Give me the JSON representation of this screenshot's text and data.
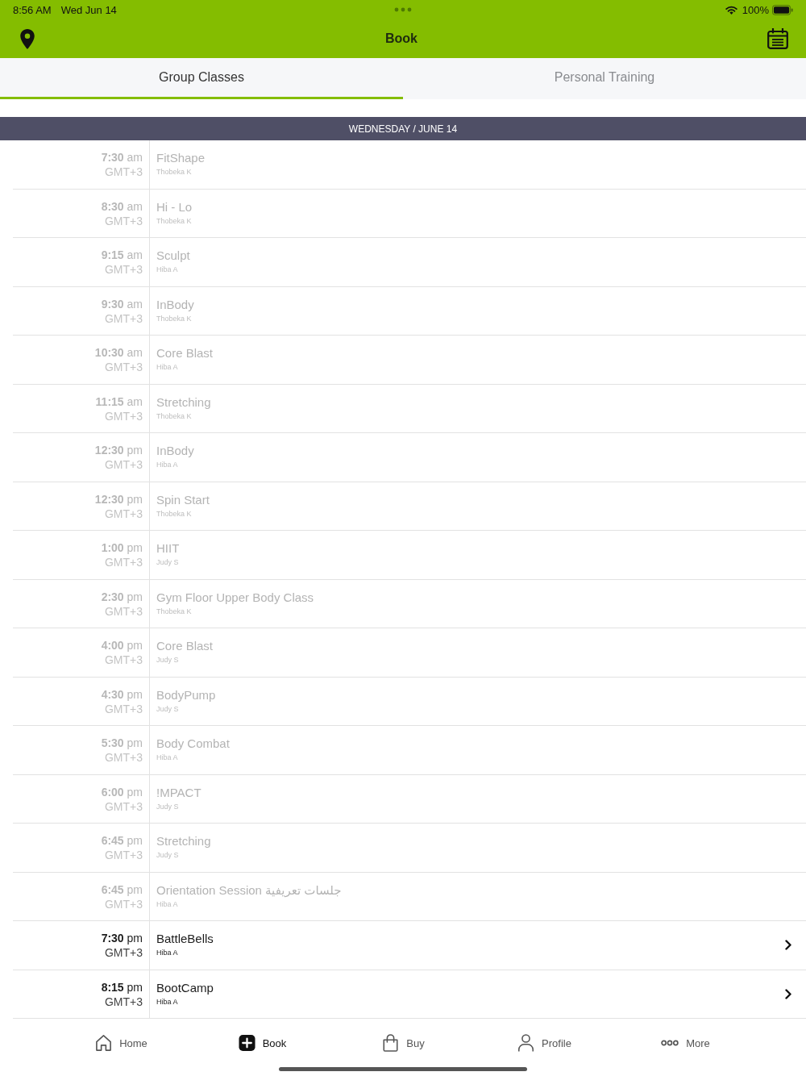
{
  "status_bar": {
    "time": "8:56 AM",
    "date": "Wed Jun 14",
    "battery": "100%"
  },
  "header": {
    "title": "Book"
  },
  "tabs": [
    {
      "label": "Group Classes",
      "selected": true
    },
    {
      "label": "Personal Training",
      "selected": false
    }
  ],
  "date_bar": "WEDNESDAY / JUNE 14",
  "classes": [
    {
      "time": "**7:30** am",
      "timezone": "GMT+3",
      "name": "FitShape",
      "instructor": "Thobeka K",
      "disabled": true
    },
    {
      "time": "**8:30** am",
      "timezone": "GMT+3",
      "name": "Hi - Lo",
      "instructor": "Thobeka K",
      "disabled": true
    },
    {
      "time": "**9:15** am",
      "timezone": "GMT+3",
      "name": "Sculpt",
      "instructor": "Hiba A",
      "disabled": true
    },
    {
      "time": "**9:30** am",
      "timezone": "GMT+3",
      "name": "InBody",
      "instructor": "Thobeka K",
      "disabled": true
    },
    {
      "time": "**10:30** am",
      "timezone": "GMT+3",
      "name": "Core Blast",
      "instructor": "Hiba A",
      "disabled": true
    },
    {
      "time": "**11:15** am",
      "timezone": "GMT+3",
      "name": "Stretching",
      "instructor": "Thobeka K",
      "disabled": true
    },
    {
      "time": "**12:30** pm",
      "timezone": "GMT+3",
      "name": "InBody",
      "instructor": "Hiba A",
      "disabled": true
    },
    {
      "time": "**12:30** pm",
      "timezone": "GMT+3",
      "name": "Spin Start",
      "instructor": "Thobeka K",
      "disabled": true
    },
    {
      "time": "**1:00** pm",
      "timezone": "GMT+3",
      "name": "HIIT",
      "instructor": "Judy S",
      "disabled": true
    },
    {
      "time": "**2:30** pm",
      "timezone": "GMT+3",
      "name": "Gym Floor Upper Body Class",
      "instructor": "Thobeka K",
      "disabled": true
    },
    {
      "time": "**4:00** pm",
      "timezone": "GMT+3",
      "name": "Core Blast",
      "instructor": "Judy S",
      "disabled": true
    },
    {
      "time": "**4:30** pm",
      "timezone": "GMT+3",
      "name": "BodyPump",
      "instructor": "Judy S",
      "disabled": true
    },
    {
      "time": "**5:30** pm",
      "timezone": "GMT+3",
      "name": "Body Combat",
      "instructor": "Hiba A",
      "disabled": true
    },
    {
      "time": "**6:00** pm",
      "timezone": "GMT+3",
      "name": "!MPACT",
      "instructor": "Judy S",
      "disabled": true
    },
    {
      "time": "**6:45** pm",
      "timezone": "GMT+3",
      "name": "Stretching",
      "instructor": "Judy S",
      "disabled": true
    },
    {
      "time": "**6:45** pm",
      "timezone": "GMT+3",
      "name": "Orientation Session جلسات تعريفية",
      "instructor": "Hiba A",
      "disabled": true
    },
    {
      "time": "**7:30** pm",
      "timezone": "GMT+3",
      "name": "BattleBells",
      "instructor": "Hiba A",
      "disabled": false
    },
    {
      "time": "**8:15** pm",
      "timezone": "GMT+3",
      "name": "BootCamp",
      "instructor": "Hiba A",
      "disabled": false
    }
  ],
  "tab_bar": [
    {
      "label": "Home",
      "selected": false
    },
    {
      "label": "Book",
      "selected": true
    },
    {
      "label": "Buy",
      "selected": false
    },
    {
      "label": "Profile",
      "selected": false
    },
    {
      "label": "More",
      "selected": false
    }
  ]
}
